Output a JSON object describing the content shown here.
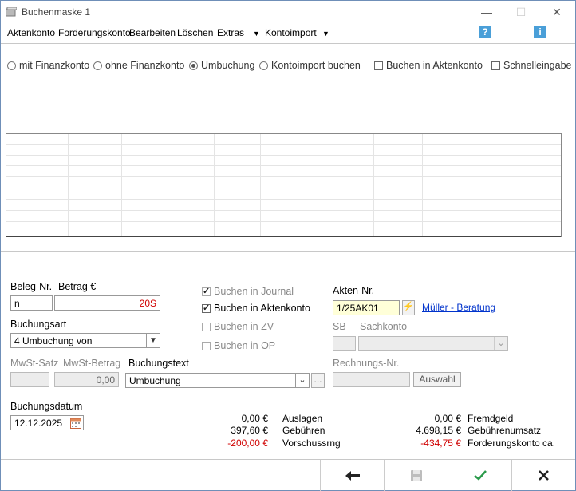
{
  "window": {
    "title": "Buchenmaske 1"
  },
  "menu": {
    "items": [
      {
        "label": "Aktenkonto"
      },
      {
        "label": "Forderungskonto"
      },
      {
        "label": "Bearbeiten"
      },
      {
        "label": "Löschen"
      },
      {
        "label": "Extras"
      },
      {
        "label": "Kontoimport"
      }
    ]
  },
  "modes": {
    "options": [
      "mit Finanzkonto",
      "ohne Finanzkonto",
      "Umbuchung",
      "Kontoimport buchen"
    ],
    "selected": "Umbuchung",
    "checks": [
      {
        "label": "Buchen in Aktenkonto",
        "checked": false
      },
      {
        "label": "Schnelleingabe",
        "checked": false
      }
    ]
  },
  "form": {
    "beleg_label": "Beleg-Nr.",
    "betrag_label": "Betrag €",
    "beleg_value": "n",
    "betrag_value": "20S",
    "buchungsart_label": "Buchungsart",
    "buchungsart_value": "4 Umbuchung von",
    "mwst_satz_label": "MwSt-Satz",
    "mwst_betrag_label": "MwSt-Betrag",
    "mwst_betrag_value": "0,00",
    "buchungstext_label": "Buchungstext",
    "buchungstext_value": "Umbuchung",
    "more_btn": "...",
    "datum_label": "Buchungsdatum",
    "datum_value": "12.12.2025",
    "buchen_checks": [
      {
        "label": "Buchen in Journal",
        "checked": true,
        "disabled": true
      },
      {
        "label": "Buchen in Aktenkonto",
        "checked": true,
        "disabled": false
      },
      {
        "label": "Buchen in ZV",
        "checked": false,
        "disabled": true
      },
      {
        "label": "Buchen in OP",
        "checked": false,
        "disabled": true
      }
    ],
    "akten_label": "Akten-Nr.",
    "akten_value": "1/25AK01",
    "akten_link": "Müller - Beratung",
    "sb_label": "SB",
    "sachkonto_label": "Sachkonto",
    "rechnungs_label": "Rechnungs-Nr.",
    "auswahl_btn": "Auswahl"
  },
  "summary": {
    "left": [
      {
        "value": "0,00 €",
        "label": "Auslagen",
        "negative": false
      },
      {
        "value": "397,60 €",
        "label": "Gebühren",
        "negative": false
      },
      {
        "value": "-200,00 €",
        "label": "Vorschussrng",
        "negative": true
      }
    ],
    "right": [
      {
        "value": "0,00 €",
        "label": "Fremdgeld",
        "negative": false
      },
      {
        "value": "4.698,15 €",
        "label": "Gebührenumsatz",
        "negative": false
      },
      {
        "value": "-434,75 €",
        "label": "Forderungskonto ca.",
        "negative": true
      }
    ]
  },
  "colors": {
    "accent": "#4a9fd8",
    "negative": "#d00000",
    "link": "#0033cc",
    "ok": "#2a9a4a"
  }
}
